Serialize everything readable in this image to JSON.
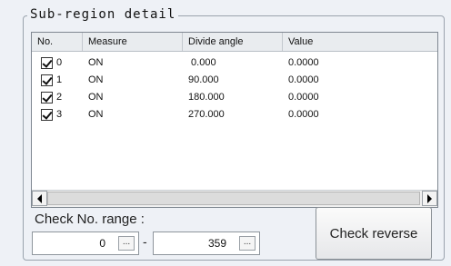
{
  "panel": {
    "title": "Sub-region detail"
  },
  "table": {
    "columns": [
      "No.",
      "Measure",
      "Divide angle",
      "Value"
    ],
    "rows": [
      {
        "no": "0",
        "checked": true,
        "measure": "ON",
        "angle": " 0.000",
        "value": "0.0000"
      },
      {
        "no": "1",
        "checked": true,
        "measure": "ON",
        "angle": "90.000",
        "value": "0.0000"
      },
      {
        "no": "2",
        "checked": true,
        "measure": "ON",
        "angle": "180.000",
        "value": "0.0000"
      },
      {
        "no": "3",
        "checked": true,
        "measure": "ON",
        "angle": "270.000",
        "value": "0.0000"
      }
    ]
  },
  "range": {
    "label": "Check No. range :",
    "from": "0",
    "dash": "-",
    "to": "359",
    "dots": "..."
  },
  "buttons": {
    "check_reverse": "Check reverse"
  }
}
